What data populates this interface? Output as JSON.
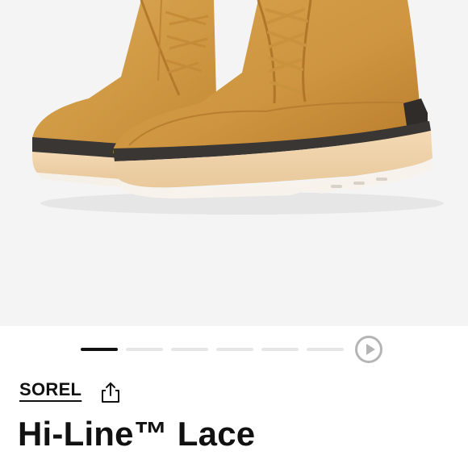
{
  "product": {
    "brand": "SOREL",
    "title": "Hi-Line™ Lace"
  },
  "gallery": {
    "image": "tan-suede-lace-up-boots",
    "slide_count": 6,
    "active_slide": 1
  },
  "icons": {
    "share": "share-icon",
    "play": "play-icon"
  },
  "colors": {
    "background": "#ffffff",
    "gallery_bg": "#f4f4f4",
    "active_indicator": "#111111",
    "inactive_indicator": "#e6e6e6",
    "play_button": "#b5b5b5",
    "text": "#111111"
  }
}
